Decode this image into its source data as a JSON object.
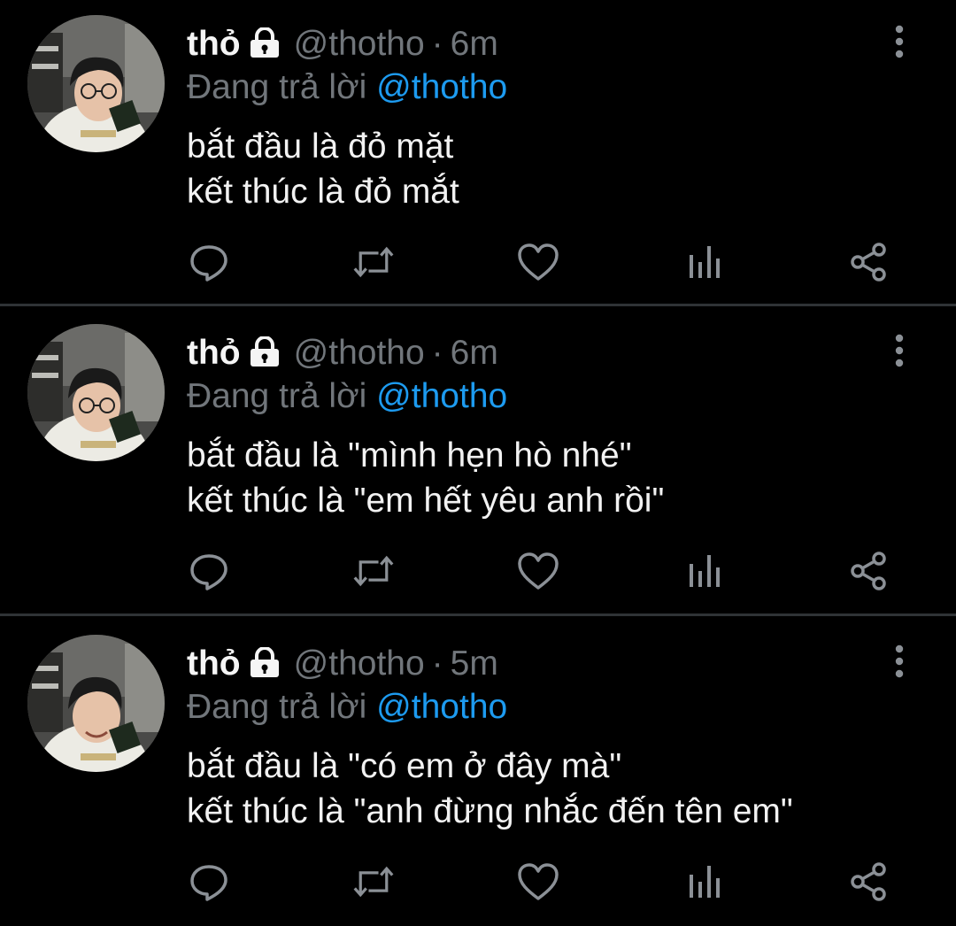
{
  "colors": {
    "background": "#000000",
    "text": "#e7e9ea",
    "muted": "#71767b",
    "accent": "#1d9bf0",
    "divider": "#2f3336"
  },
  "icons": {
    "lock": "lock-icon",
    "more": "more-vertical-icon",
    "reply": "reply-icon",
    "retweet": "retweet-icon",
    "like": "heart-icon",
    "views": "analytics-icon",
    "share": "share-icon"
  },
  "tweets": [
    {
      "name": "thỏ",
      "handle": "@thotho",
      "separator": "·",
      "time": "6m",
      "reply_label": "Đang trả lời",
      "reply_to": "@thotho",
      "lines": [
        "bắt đầu là đỏ mặt",
        "kết thúc là đỏ mắt"
      ]
    },
    {
      "name": "thỏ",
      "handle": "@thotho",
      "separator": "·",
      "time": "6m",
      "reply_label": "Đang trả lời",
      "reply_to": "@thotho",
      "lines": [
        "bắt đầu là \"mình hẹn hò nhé\"",
        "kết thúc là \"em hết yêu anh rồi\""
      ]
    },
    {
      "name": "thỏ",
      "handle": "@thotho",
      "separator": "·",
      "time": "5m",
      "reply_label": "Đang trả lời",
      "reply_to": "@thotho",
      "lines": [
        "bắt đầu là \"có em ở đây mà\"",
        "kết thúc là \"anh đừng nhắc đến tên em\""
      ]
    }
  ]
}
